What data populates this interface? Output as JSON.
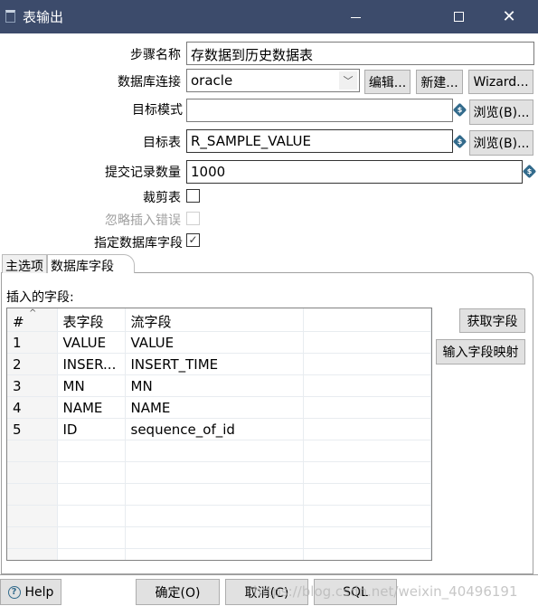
{
  "window": {
    "title": "表输出",
    "minimize_icon": "minimize-icon",
    "maximize_icon": "maximize-icon",
    "close_icon": "close-icon"
  },
  "form": {
    "step_name": {
      "label": "步骤名称",
      "value": "存数据到历史数据表"
    },
    "db_connection": {
      "label": "数据库连接",
      "value": "oracle",
      "edit_button": "编辑...",
      "new_button": "新建...",
      "wizard_button": "Wizard..."
    },
    "target_schema": {
      "label": "目标模式",
      "value": "",
      "browse_button": "浏览(B)..."
    },
    "target_table": {
      "label": "目标表",
      "value": "R_SAMPLE_VALUE",
      "browse_button": "浏览(B)..."
    },
    "commit_size": {
      "label": "提交记录数量",
      "value": "1000"
    },
    "truncate_table": {
      "label": "裁剪表",
      "checked": false,
      "mark": ""
    },
    "ignore_insert_errors": {
      "label": "忽略插入错误",
      "checked": false,
      "disabled": true,
      "mark": ""
    },
    "specify_db_fields": {
      "label": "指定数据库字段",
      "checked": true,
      "mark": "✓"
    },
    "variable_icon_glyph": "$"
  },
  "tabs": [
    {
      "label": "主选项",
      "active": false
    },
    {
      "label": "数据库字段",
      "active": true
    }
  ],
  "fields_panel": {
    "label": "插入的字段:",
    "sort_caret": "^",
    "columns": [
      "#",
      "表字段",
      "流字段",
      ""
    ],
    "rows": [
      [
        "1",
        "VALUE",
        "VALUE",
        ""
      ],
      [
        "2",
        "INSER...",
        "INSERT_TIME",
        ""
      ],
      [
        "3",
        "MN",
        "MN",
        ""
      ],
      [
        "4",
        "NAME",
        "NAME",
        ""
      ],
      [
        "5",
        "ID",
        "sequence_of_id",
        ""
      ],
      [
        "",
        "",
        "",
        ""
      ],
      [
        "",
        "",
        "",
        ""
      ],
      [
        "",
        "",
        "",
        ""
      ],
      [
        "",
        "",
        "",
        ""
      ],
      [
        "",
        "",
        "",
        ""
      ],
      [
        "",
        "",
        "",
        ""
      ]
    ],
    "get_fields_button": "获取字段",
    "input_mapping_button": "输入字段映射"
  },
  "footer": {
    "help_button": "Help",
    "help_glyph": "?",
    "ok_button": "确定(O)",
    "cancel_button": "取消(C)",
    "sql_button": "SQL"
  },
  "watermark": "https://blog.csdn.net/weixin_40496191"
}
